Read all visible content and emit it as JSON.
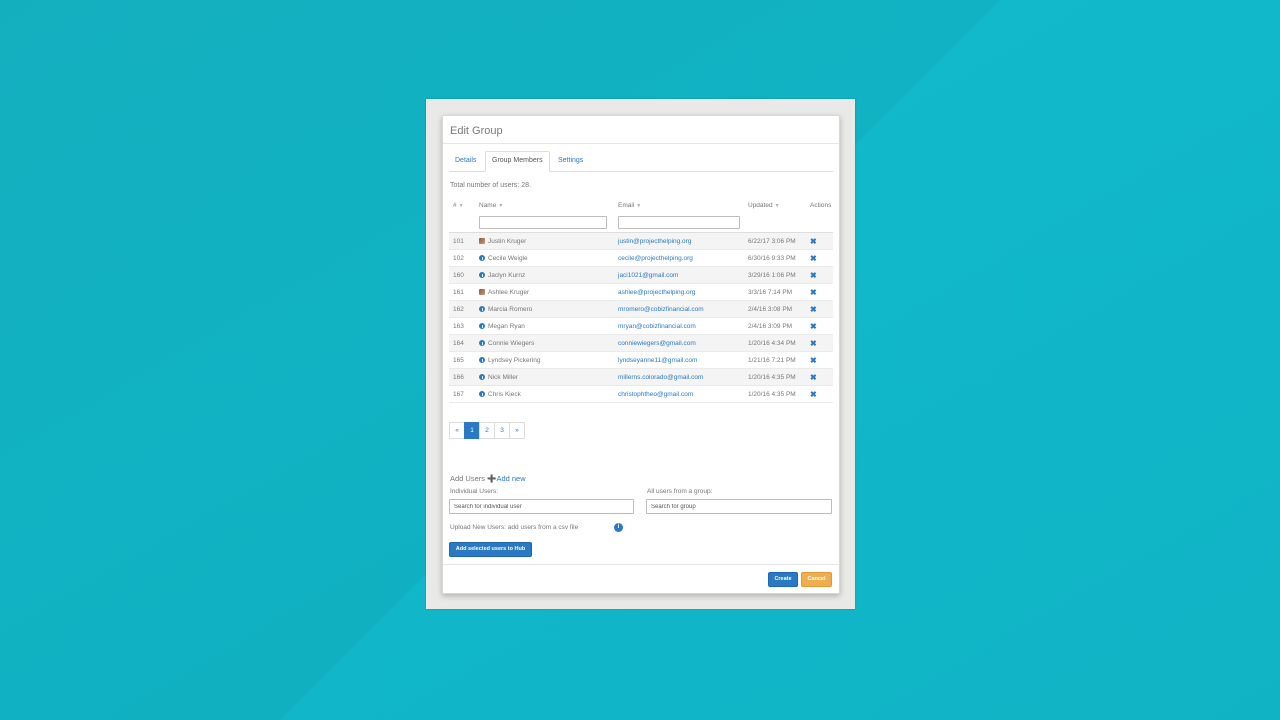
{
  "modal": {
    "title": "Edit Group",
    "tabs": [
      {
        "label": "Details",
        "active": false
      },
      {
        "label": "Group Members",
        "active": true
      },
      {
        "label": "Settings",
        "active": false
      }
    ],
    "total_text": "Total number of users: 28.",
    "columns": {
      "num": "#",
      "name": "Name",
      "email": "Email",
      "updated": "Updated",
      "actions": "Actions"
    },
    "rows": [
      {
        "num": "101",
        "name": "Justin Kruger",
        "email": "justin@projecthelping.org",
        "updated": "6/22/17 3:06 PM",
        "avatar": "photo"
      },
      {
        "num": "102",
        "name": "Cecile Weigle",
        "email": "cecile@projecthelping.org",
        "updated": "6/30/16 9:33 PM",
        "avatar": "generic"
      },
      {
        "num": "160",
        "name": "Jaclyn Kurnz",
        "email": "jaci1021@gmail.com",
        "updated": "3/29/16 1:06 PM",
        "avatar": "generic"
      },
      {
        "num": "161",
        "name": "Ashlee Kruger",
        "email": "ashlee@projecthelping.org",
        "updated": "3/3/16 7:14 PM",
        "avatar": "photo"
      },
      {
        "num": "162",
        "name": "Marcia Romero",
        "email": "mromero@cobizfinancial.com",
        "updated": "2/4/16 3:08 PM",
        "avatar": "generic"
      },
      {
        "num": "163",
        "name": "Megan Ryan",
        "email": "mryan@cobizfinancial.com",
        "updated": "2/4/16 3:09 PM",
        "avatar": "generic"
      },
      {
        "num": "164",
        "name": "Connie Wiegers",
        "email": "conniewiegers@gmail.com",
        "updated": "1/20/16 4:34 PM",
        "avatar": "generic"
      },
      {
        "num": "165",
        "name": "Lyndsey Pickering",
        "email": "lyndseyanne11@gmail.com",
        "updated": "1/21/16 7:21 PM",
        "avatar": "generic"
      },
      {
        "num": "166",
        "name": "Nick Miller",
        "email": "millerns.colorado@gmail.com",
        "updated": "1/20/16 4:35 PM",
        "avatar": "generic"
      },
      {
        "num": "167",
        "name": "Chris Kieck",
        "email": "christophtheo@gmail.com",
        "updated": "1/20/16 4:35 PM",
        "avatar": "generic"
      }
    ],
    "delete_glyph": "✖",
    "pagination": {
      "prev": "«",
      "pages": [
        "1",
        "2",
        "3"
      ],
      "next": "»",
      "current": "1"
    },
    "add_users": {
      "label": "Add Users",
      "add_new": "➕Add new",
      "individual_label": "Individual Users:",
      "individual_placeholder": "Search for individual user",
      "group_label": "All users from a group:",
      "group_placeholder": "Search for group",
      "upload_text": "Upload New Users: add users from a csv file",
      "info_glyph": "i",
      "add_button": "Add selected users to Hub"
    },
    "footer": {
      "create": "Create",
      "cancel": "Cancel"
    }
  },
  "colors": {
    "background": "#11b9cb",
    "accent": "#2a79c4",
    "cancel": "#f0ad4e"
  }
}
